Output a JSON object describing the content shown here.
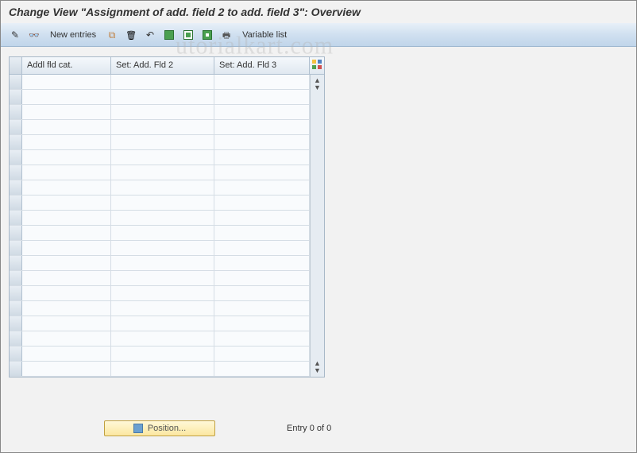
{
  "title": "Change View \"Assignment of add. field 2 to add. field 3\": Overview",
  "toolbar": {
    "new_entries_label": "New entries",
    "variable_list_label": "Variable list"
  },
  "columns": {
    "addl_fld_cat": "Addl fld cat.",
    "set_add_fld_2": "Set: Add. Fld 2",
    "set_add_fld_3": "Set: Add. Fld 3"
  },
  "rows": [
    {
      "addl_fld_cat": "",
      "set_add_fld_2": "",
      "set_add_fld_3": ""
    },
    {
      "addl_fld_cat": "",
      "set_add_fld_2": "",
      "set_add_fld_3": ""
    },
    {
      "addl_fld_cat": "",
      "set_add_fld_2": "",
      "set_add_fld_3": ""
    },
    {
      "addl_fld_cat": "",
      "set_add_fld_2": "",
      "set_add_fld_3": ""
    },
    {
      "addl_fld_cat": "",
      "set_add_fld_2": "",
      "set_add_fld_3": ""
    },
    {
      "addl_fld_cat": "",
      "set_add_fld_2": "",
      "set_add_fld_3": ""
    },
    {
      "addl_fld_cat": "",
      "set_add_fld_2": "",
      "set_add_fld_3": ""
    },
    {
      "addl_fld_cat": "",
      "set_add_fld_2": "",
      "set_add_fld_3": ""
    },
    {
      "addl_fld_cat": "",
      "set_add_fld_2": "",
      "set_add_fld_3": ""
    },
    {
      "addl_fld_cat": "",
      "set_add_fld_2": "",
      "set_add_fld_3": ""
    },
    {
      "addl_fld_cat": "",
      "set_add_fld_2": "",
      "set_add_fld_3": ""
    },
    {
      "addl_fld_cat": "",
      "set_add_fld_2": "",
      "set_add_fld_3": ""
    },
    {
      "addl_fld_cat": "",
      "set_add_fld_2": "",
      "set_add_fld_3": ""
    },
    {
      "addl_fld_cat": "",
      "set_add_fld_2": "",
      "set_add_fld_3": ""
    },
    {
      "addl_fld_cat": "",
      "set_add_fld_2": "",
      "set_add_fld_3": ""
    },
    {
      "addl_fld_cat": "",
      "set_add_fld_2": "",
      "set_add_fld_3": ""
    },
    {
      "addl_fld_cat": "",
      "set_add_fld_2": "",
      "set_add_fld_3": ""
    },
    {
      "addl_fld_cat": "",
      "set_add_fld_2": "",
      "set_add_fld_3": ""
    },
    {
      "addl_fld_cat": "",
      "set_add_fld_2": "",
      "set_add_fld_3": ""
    },
    {
      "addl_fld_cat": "",
      "set_add_fld_2": "",
      "set_add_fld_3": ""
    }
  ],
  "footer": {
    "position_label": "Position...",
    "entry_status": "Entry 0 of 0"
  },
  "watermark": "utorialkart.com"
}
